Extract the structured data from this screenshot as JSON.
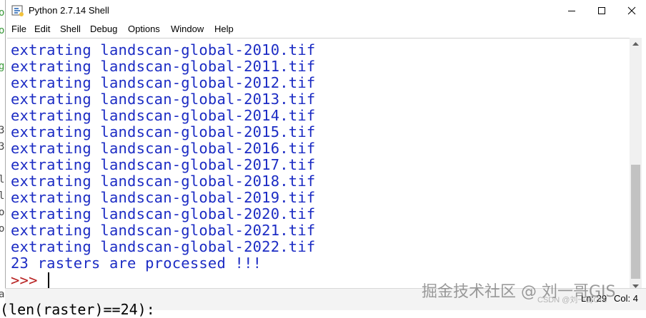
{
  "window": {
    "title": "Python 2.7.14 Shell",
    "controls": {
      "minimize": "minimize",
      "maximize": "maximize",
      "close": "close"
    }
  },
  "menu": [
    "File",
    "Edit",
    "Shell",
    "Debug",
    "Options",
    "Window",
    "Help"
  ],
  "shell": {
    "output_lines": [
      "extrating landscan-global-2010.tif",
      "extrating landscan-global-2011.tif",
      "extrating landscan-global-2012.tif",
      "extrating landscan-global-2013.tif",
      "extrating landscan-global-2014.tif",
      "extrating landscan-global-2015.tif",
      "extrating landscan-global-2016.tif",
      "extrating landscan-global-2017.tif",
      "extrating landscan-global-2018.tif",
      "extrating landscan-global-2019.tif",
      "extrating landscan-global-2020.tif",
      "extrating landscan-global-2021.tif",
      "extrating landscan-global-2022.tif",
      "23 rasters are processed !!!"
    ],
    "prompt": ">>> "
  },
  "status": {
    "line": "Ln: 29",
    "col": "Col: 4"
  },
  "watermark": "掘金技术社区 @ 刘一哥GIS",
  "csdn_mark": "CSDN @刘一哥GIS",
  "behind_code": "(len(raster)==24):",
  "colors": {
    "output": "#1c2cc4",
    "prompt": "#b82222"
  }
}
